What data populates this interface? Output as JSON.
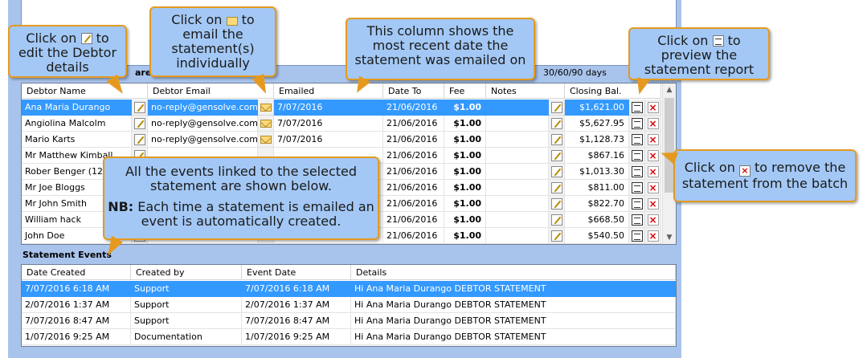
{
  "debtors_header_fragment": "are",
  "aging_label": "30/60/90 days",
  "debtor_grid": {
    "columns": [
      "Debtor Name",
      "Debtor Email",
      "Emailed",
      "Date To",
      "Fee",
      "Notes",
      "Closing Bal."
    ],
    "rows": [
      {
        "name": "Ana Maria Durango",
        "email": "no-reply@gensolve.com",
        "emailed": "7/07/2016",
        "date_to": "21/06/2016",
        "fee": "$1.00",
        "notes": "",
        "closing": "$1,621.00",
        "selected": true
      },
      {
        "name": "Angiolina Malcolm",
        "email": "no-reply@gensolve.com",
        "emailed": "7/07/2016",
        "date_to": "21/06/2016",
        "fee": "$1.00",
        "notes": "",
        "closing": "$5,627.95"
      },
      {
        "name": "Mario Karts",
        "email": "no-reply@gensolve.com",
        "emailed": "7/07/2016",
        "date_to": "21/06/2016",
        "fee": "$1.00",
        "notes": "",
        "closing": "$1,128.73"
      },
      {
        "name": "Mr Matthew Kimball",
        "email": "",
        "emailed": "",
        "date_to": "21/06/2016",
        "fee": "$1.00",
        "notes": "",
        "closing": "$867.16"
      },
      {
        "name": "Rober Benger (1234",
        "email": "",
        "emailed": "",
        "date_to": "21/06/2016",
        "fee": "$1.00",
        "notes": "",
        "closing": "$1,013.30"
      },
      {
        "name": "Mr Joe Bloggs",
        "email": "",
        "emailed": "",
        "date_to": "21/06/2016",
        "fee": "$1.00",
        "notes": "",
        "closing": "$811.00"
      },
      {
        "name": "Mr John Smith",
        "email": "",
        "emailed": "",
        "date_to": "21/06/2016",
        "fee": "$1.00",
        "notes": "",
        "closing": "$822.70"
      },
      {
        "name": "William hack",
        "email": "",
        "emailed": "",
        "date_to": "21/06/2016",
        "fee": "$1.00",
        "notes": "",
        "closing": "$668.50"
      },
      {
        "name": "John Doe",
        "email": "",
        "emailed": "",
        "date_to": "21/06/2016",
        "fee": "$1.00",
        "notes": "",
        "closing": "$540.50"
      }
    ]
  },
  "events_section_label": "Statement Events",
  "events_grid": {
    "columns": [
      "Date Created",
      "Created by",
      "Event Date",
      "Details"
    ],
    "rows": [
      {
        "date_created": "7/07/2016 6:18 AM",
        "created_by": "Support",
        "event_date": "7/07/2016 6:18 AM",
        "details": "Hi  Ana Maria Durango DEBTOR STATEMENT",
        "selected": true
      },
      {
        "date_created": "2/07/2016 1:37 AM",
        "created_by": "Support",
        "event_date": "2/07/2016 1:37 AM",
        "details": "Hi  Ana Maria Durango DEBTOR STATEMENT"
      },
      {
        "date_created": "7/07/2016 8:47 AM",
        "created_by": "Support",
        "event_date": "7/07/2016 8:47 AM",
        "details": "Hi  Ana Maria Durango DEBTOR STATEMENT"
      },
      {
        "date_created": "1/07/2016 9:25 AM",
        "created_by": "Documentation",
        "event_date": "1/07/2016 9:25 AM",
        "details": "Hi  Ana Maria Durango DEBTOR STATEMENT"
      }
    ]
  },
  "callouts": {
    "edit": {
      "before": "Click on",
      "after": "to",
      "rest": "edit the Debtor details"
    },
    "email": {
      "before": "Click on",
      "after": "to",
      "rest": "email the statement(s) individually"
    },
    "emailed_col": {
      "text": "This column shows the most recent date the statement was emailed on"
    },
    "preview": {
      "before": "Click on",
      "after": "to",
      "rest": "preview the statement report"
    },
    "remove": {
      "before": "Click on",
      "after": "to remove the",
      "rest": "statement from the batch"
    },
    "events": {
      "line1": "All the events linked to the selected statement are shown below.",
      "nb_label": "NB:",
      "nb_text": "Each time a statement is emailed an event is automatically created."
    }
  },
  "colors": {
    "selection": "#3399ff",
    "callout_fill": "#a3c8f5",
    "callout_border": "#e59a1f",
    "delete_red": "#d40000"
  }
}
